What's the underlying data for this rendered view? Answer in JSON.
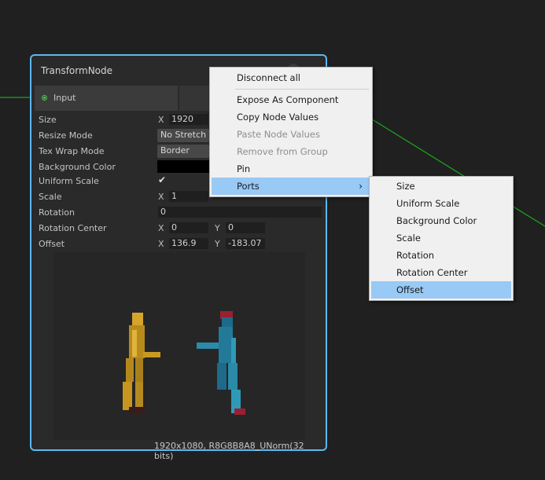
{
  "node": {
    "title": "TransformNode",
    "input_port": "Input",
    "properties": [
      {
        "label": "Size"
      },
      {
        "label": "Resize Mode"
      },
      {
        "label": "Tex Wrap Mode"
      },
      {
        "label": "Background Color"
      },
      {
        "label": "Uniform Scale"
      },
      {
        "label": "Scale"
      },
      {
        "label": "Rotation"
      },
      {
        "label": "Rotation Center"
      },
      {
        "label": "Offset"
      }
    ],
    "size": {
      "x_axis": "X",
      "x": "1920"
    },
    "resize_mode": "No Stretch",
    "wrap_mode": "Border",
    "background_color": "#000000",
    "uniform_scale_checked": true,
    "uniform_scale_check_glyph": "✔",
    "scale": {
      "x_axis": "X",
      "x": "1"
    },
    "rotation": "0",
    "rotation_center": {
      "x_axis": "X",
      "x": "0",
      "y_axis": "Y",
      "y": "0"
    },
    "offset": {
      "x_axis": "X",
      "x": "136.9",
      "y_axis": "Y",
      "y": "-183.07"
    },
    "preview_info": "1920x1080, R8G8B8A8_UNorm(32 bits)"
  },
  "context_menu": {
    "items": [
      {
        "label": "Disconnect all",
        "enabled": true
      },
      {
        "label": "Expose As Component",
        "enabled": true
      },
      {
        "label": "Copy Node Values",
        "enabled": true
      },
      {
        "label": "Paste Node Values",
        "enabled": false
      },
      {
        "label": "Remove from Group",
        "enabled": false
      },
      {
        "label": "Pin",
        "enabled": true
      },
      {
        "label": "Ports",
        "enabled": true,
        "submenu": true,
        "highlighted": true
      }
    ],
    "submenu_arrow": "›"
  },
  "ports_submenu": {
    "items": [
      {
        "label": "Size"
      },
      {
        "label": "Uniform Scale"
      },
      {
        "label": "Background Color"
      },
      {
        "label": "Scale"
      },
      {
        "label": "Rotation"
      },
      {
        "label": "Rotation Center"
      },
      {
        "label": "Offset",
        "highlighted": true
      }
    ]
  },
  "colors": {
    "accent": "#5cb8f0",
    "edge": "#1fa01f",
    "highlight": "#99c9f5",
    "canvas": "#202020"
  }
}
